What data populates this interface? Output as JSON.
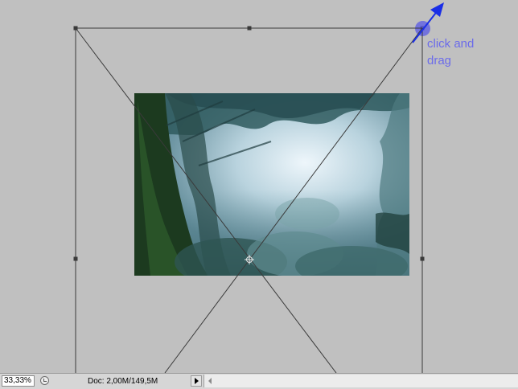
{
  "annotation": {
    "hint_line1": "click and",
    "hint_line2": "drag",
    "color": "#6b6bea",
    "arrow_color": "#1a2ee6"
  },
  "status_bar": {
    "zoom_value": "33,33%",
    "doc_info": "Doc: 2,00M/149,5M",
    "icons": [
      "status-cycle-icon",
      "play-arrow-icon",
      "scroll-left-arrow-icon"
    ]
  },
  "colors": {
    "workspace": "#c0c0c0",
    "bounding_box": "#3a3a3a",
    "status_bar": "#d6d6d6"
  }
}
